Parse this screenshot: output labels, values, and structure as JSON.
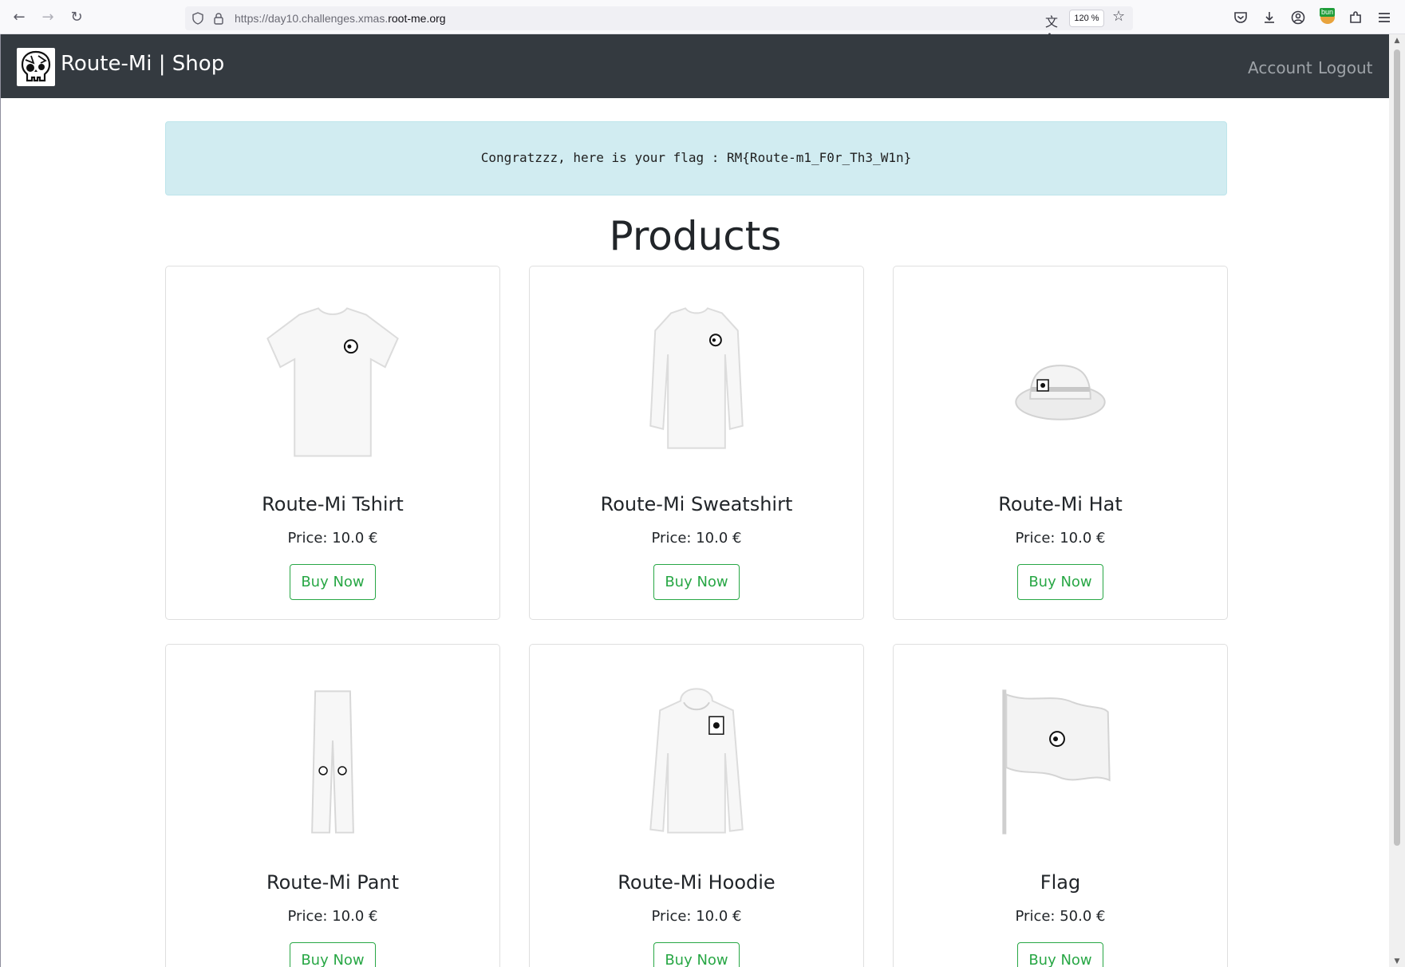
{
  "browser": {
    "url_prefix": "https://day10.challenges.xmas.",
    "url_domain": "root-me.org",
    "zoom": "120 %",
    "extension_badge": "bun"
  },
  "navbar": {
    "brand": "Route-Mi | Shop",
    "links": [
      "Account",
      "Logout"
    ]
  },
  "alert": {
    "message": "Congratzzz, here is your flag : RM{Route-m1_F0r_Th3_W1n}"
  },
  "heading": "Products",
  "products": [
    {
      "name": "Route-Mi Tshirt",
      "price": "Price: 10.0 €",
      "button": "Buy Now",
      "icon": "tshirt-image"
    },
    {
      "name": "Route-Mi Sweatshirt",
      "price": "Price: 10.0 €",
      "button": "Buy Now",
      "icon": "sweatshirt-image"
    },
    {
      "name": "Route-Mi Hat",
      "price": "Price: 10.0 €",
      "button": "Buy Now",
      "icon": "hat-image"
    },
    {
      "name": "Route-Mi Pant",
      "price": "Price: 10.0 €",
      "button": "Buy Now",
      "icon": "pant-image"
    },
    {
      "name": "Route-Mi Hoodie",
      "price": "Price: 10.0 €",
      "button": "Buy Now",
      "icon": "hoodie-image"
    },
    {
      "name": "Flag",
      "price": "Price: 50.0 €",
      "button": "Buy Now",
      "icon": "flag-image"
    }
  ],
  "colors": {
    "navbar": "#343a40",
    "alert_bg": "#d1ecf1",
    "button_accent": "#28a745"
  }
}
